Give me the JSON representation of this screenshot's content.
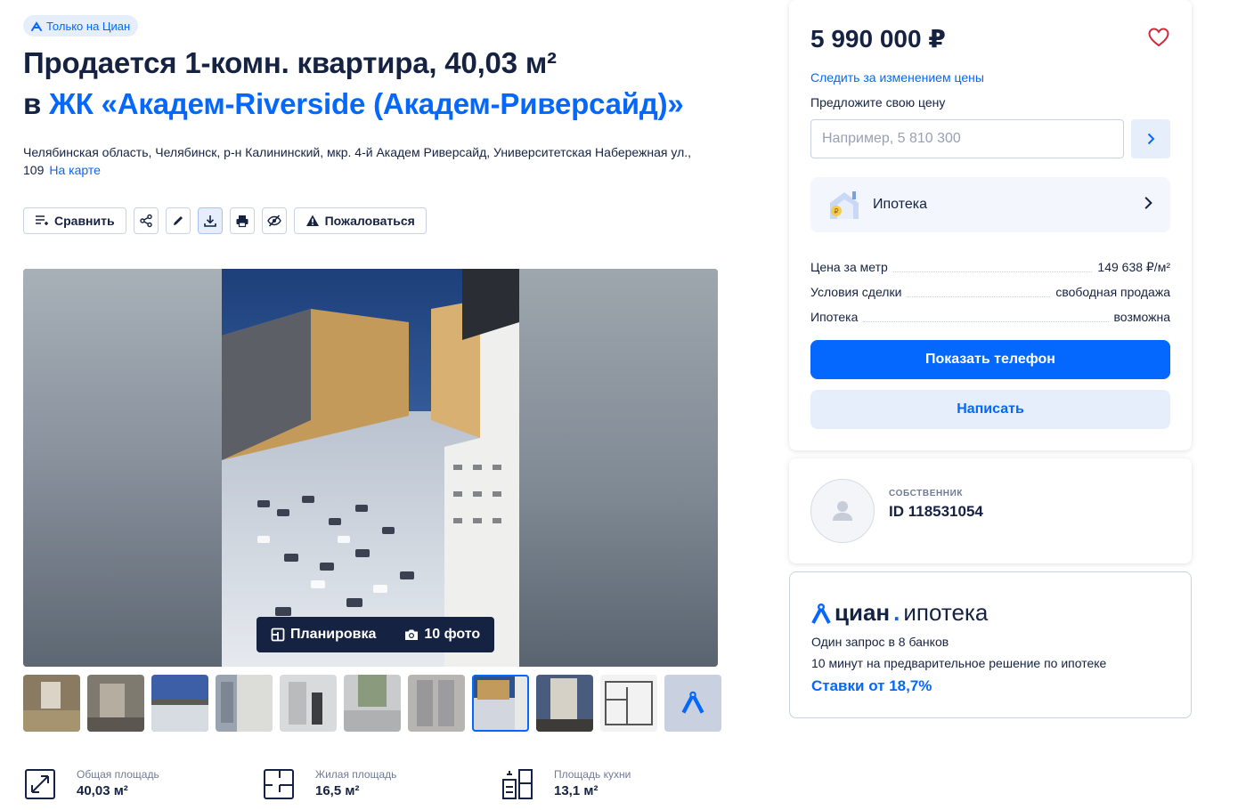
{
  "badge": {
    "label": "Только на Циан"
  },
  "title": {
    "line1": "Продается 1-комн. квартира, 40,03 м²",
    "prefix": "в ",
    "complex_link": "ЖК «Академ-Riverside (Академ-Риверсайд)»"
  },
  "address": {
    "text": "Челябинская область, Челябинск, р-н Калининский, мкр. 4-й Академ Риверсайд, Университетская Набережная ул., 109",
    "map_link": "На карте"
  },
  "toolbar": {
    "compare_label": "Сравнить",
    "report_label": "Пожаловаться",
    "icons": [
      "share-icon",
      "edit-icon",
      "download-icon",
      "print-icon",
      "hide-icon"
    ]
  },
  "gallery": {
    "plan_label": "Планировка",
    "photos_label": "10 фото",
    "thumbnail_count": 11,
    "selected_thumbnail": 8
  },
  "facts": [
    {
      "label": "Общая площадь",
      "value": "40,03 м²",
      "icon": "total-area-icon"
    },
    {
      "label": "Жилая площадь",
      "value": "16,5 м²",
      "icon": "living-area-icon"
    },
    {
      "label": "Площадь кухни",
      "value": "13,1 м²",
      "icon": "kitchen-icon"
    }
  ],
  "price_card": {
    "price": "5 990 000 ₽",
    "follow_price": "Следить за изменением цены",
    "offer_label": "Предложите свою цену",
    "offer_placeholder": "Например, 5 810 300",
    "mortgage_label": "Ипотека",
    "specs": [
      {
        "key": "Цена за метр",
        "value": "149 638 ₽/м²"
      },
      {
        "key": "Условия сделки",
        "value": "свободная продажа"
      },
      {
        "key": "Ипотека",
        "value": "возможна"
      }
    ],
    "show_phone": "Показать телефон",
    "write": "Написать"
  },
  "owner": {
    "role": "СОБСТВЕННИК",
    "id": "ID 118531054"
  },
  "ipoteka": {
    "logo_brand": "циан",
    "logo_suffix": "ипотека",
    "line1": "Один запрос в 8 банков",
    "line2": "10 минут на предварительное решение по ипотеке",
    "rates": "Ставки от 18,7%"
  },
  "colors": {
    "accent": "#0468ff",
    "text": "#152242",
    "muted": "#707a95",
    "light_accent_bg": "#e6eefc",
    "heart": "#d1293a"
  }
}
